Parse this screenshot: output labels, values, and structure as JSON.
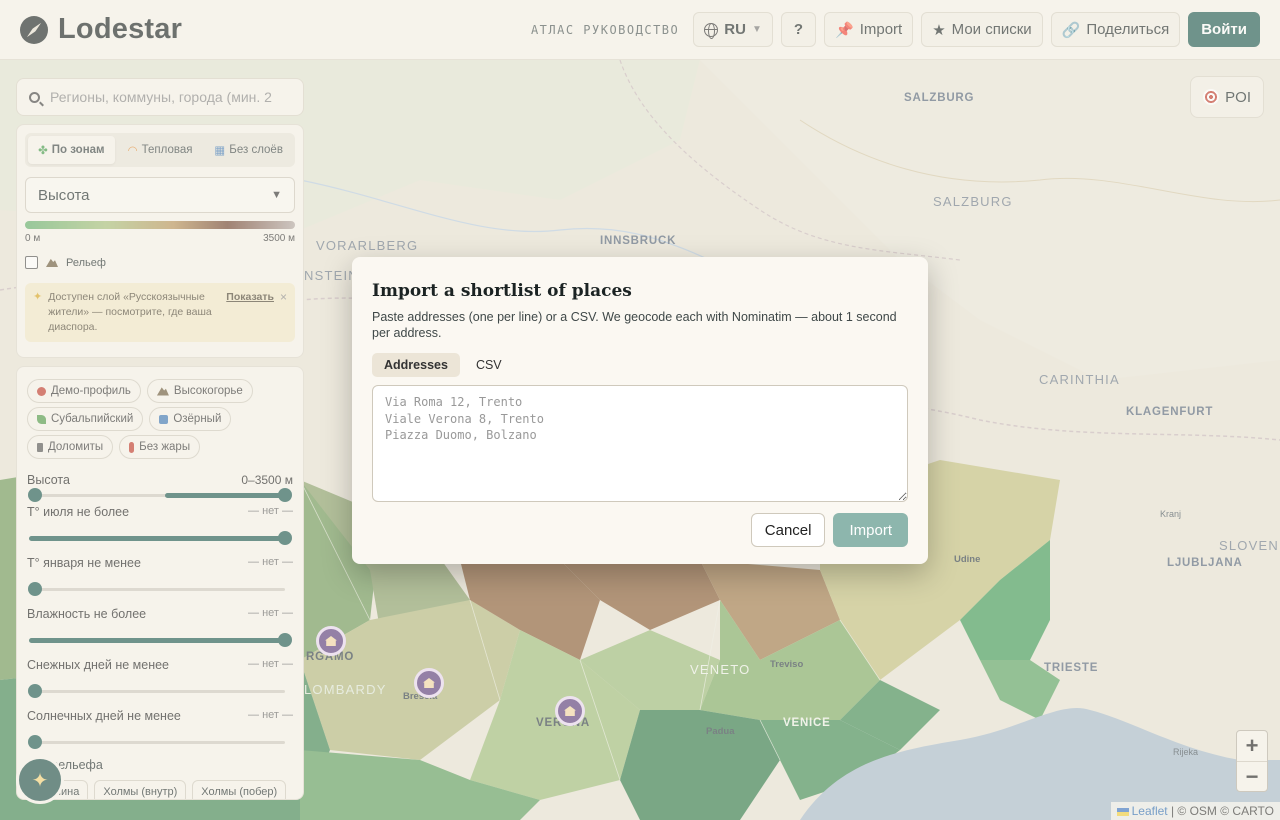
{
  "header": {
    "logo_text": "Lodestar",
    "atlas_link": "АТЛАС РУКОВОДСТВО",
    "language": "RU",
    "help_label": "?",
    "import_label": "Import",
    "lists_label": "Мои списки",
    "share_label": "Поделиться",
    "login_label": "Войти"
  },
  "search": {
    "placeholder": "Регионы, коммуны, города (мин. 2"
  },
  "layer_modes": [
    {
      "label": "По зонам",
      "active": true
    },
    {
      "label": "Тепловая",
      "active": false
    },
    {
      "label": "Без слоёв",
      "active": false
    }
  ],
  "metric_select": {
    "value": "Высота"
  },
  "legend": {
    "min_label": "0 м",
    "max_label": "3500 м"
  },
  "relief_toggle": {
    "label": "Рельеф",
    "checked": false
  },
  "notice": {
    "text": "Доступен слой «Русскоязычные жители» — посмотрите, где ваша диаспора.",
    "action": "Показать",
    "close": "×"
  },
  "presets": [
    {
      "label": "Демо-профиль",
      "icon": "target-icon",
      "color": "#c0392b"
    },
    {
      "label": "Высокогорье",
      "icon": "mountain-icon",
      "color": "#6b5a3a"
    },
    {
      "label": "Субальпийский",
      "icon": "leaf-icon",
      "color": "#4f9a48"
    },
    {
      "label": "Озёрный",
      "icon": "lake-icon",
      "color": "#3b76b5"
    },
    {
      "label": "Доломиты",
      "icon": "ski-icon",
      "color": "#555555"
    },
    {
      "label": "Без жары",
      "icon": "thermometer-icon",
      "color": "#c0392b"
    }
  ],
  "filters": [
    {
      "label": "Высота",
      "value": "0–3500 м",
      "range": [
        0.0,
        1.0
      ],
      "dual": true
    },
    {
      "label": "T° июля не более",
      "value": "— нет —",
      "level": 1.0
    },
    {
      "label": "T° января не менее",
      "value": "— нет —",
      "level": 0.0
    },
    {
      "label": "Влажность не более",
      "value": "— нет —",
      "level": 1.0
    },
    {
      "label": "Снежных дней не менее",
      "value": "— нет —",
      "level": 0.0
    },
    {
      "label": "Солнечных дней не менее",
      "value": "— нет —",
      "level": 0.0
    }
  ],
  "relief_types": {
    "title": "Тип рельефа",
    "options": [
      "Равнина",
      "Холмы (внутр)",
      "Холмы (побер)"
    ]
  },
  "map": {
    "poi_label": "POI",
    "zoom_in": "+",
    "zoom_out": "−",
    "attribution_leaflet": "Leaflet",
    "attribution_rest": " | © OSM © CARTO",
    "labels": [
      "SALZBURG",
      "SALZBURG",
      "INNSBRUCK",
      "VORARLBERG",
      "CARINTHIA",
      "KLAGENFURT",
      "SLOVEN",
      "LJUBLJANA",
      "Kranj",
      "Udine",
      "TRIESTE",
      "Rijeka",
      "VENETO",
      "Treviso",
      "VENICE",
      "Padua",
      "VERONA",
      "Brescia",
      "LOMBARDY",
      "RGAMO",
      "NSTEIN"
    ]
  },
  "modal": {
    "title": "Import a shortlist of places",
    "description": "Paste addresses (one per line) or a CSV. We geocode each with Nominatim — about 1 second per address.",
    "tabs": [
      {
        "label": "Addresses",
        "active": true
      },
      {
        "label": "CSV",
        "active": false
      }
    ],
    "textarea_placeholder": "Via Roma 12, Trento\nViale Verona 8, Trento\nPiazza Duomo, Bolzano",
    "cancel_label": "Cancel",
    "import_label": "Import"
  },
  "colors": {
    "accent": "#1e5a52",
    "import_disabled": "#8db6ad",
    "notice_bg": "#f3e9c8",
    "poi_pin": "#5a3b7d"
  }
}
